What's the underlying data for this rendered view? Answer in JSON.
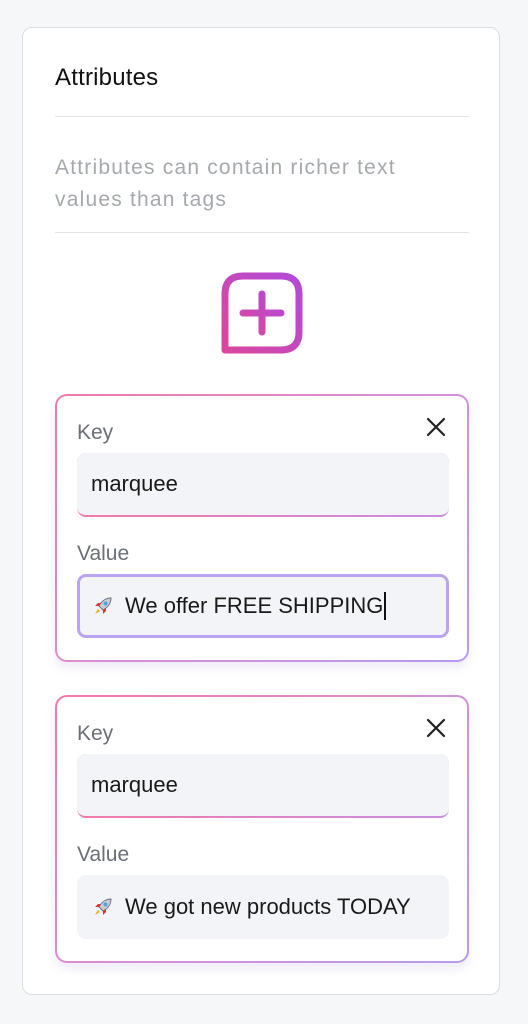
{
  "panel": {
    "title": "Attributes",
    "description": "Attributes can contain richer text values than tags",
    "add_icon": "plus-square-icon"
  },
  "attributes": [
    {
      "key_label": "Key",
      "key_value": "marquee",
      "value_label": "Value",
      "value_icon": "rocket-icon",
      "value_text": "We offer FREE SHIPPING",
      "focused": true
    },
    {
      "key_label": "Key",
      "key_value": "marquee",
      "value_label": "Value",
      "value_icon": "rocket-icon",
      "value_text": "We got new products TODAY",
      "focused": false
    }
  ],
  "colors": {
    "gradient_pink": "#f07aa8",
    "gradient_purple": "#b79bf0",
    "add_icon_pink": "#d9479e",
    "add_icon_purple": "#b24ad9",
    "focus_border": "#bba4ef"
  }
}
